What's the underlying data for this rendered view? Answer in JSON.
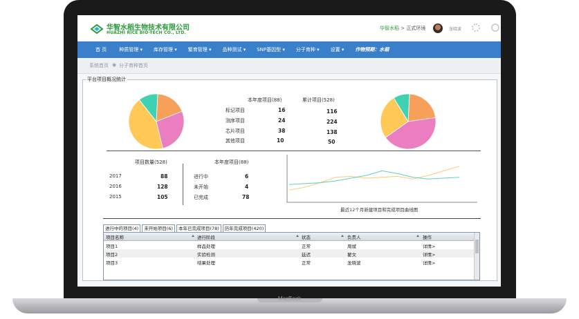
{
  "header": {
    "company_cn": "华智水稻生物技术有限公司",
    "company_en": "HUAZHI RICE BIO-TECH CO., LTD.",
    "crumb_link": "华智水稻",
    "crumb_sep": ">",
    "crumb_env": "正式环境",
    "user_name": "龙晓波"
  },
  "nav": {
    "items": [
      "首 页",
      "种质管理 ▾",
      "库存管理 ▾",
      "繁育管理 ▾",
      "品种测试 ▾",
      "SNP基因型 ▾",
      "分子育种 ▾",
      "设置 ▾"
    ],
    "crop": "作物预期：水稻"
  },
  "breadcrumb": {
    "first": "系统首页",
    "sep": "◉",
    "current": "分子育种首页"
  },
  "panel": {
    "legend": "平台项目概况统计"
  },
  "year_stats": {
    "header": "本年度项目(88)",
    "rows": [
      {
        "label": "标记项目",
        "value": "16"
      },
      {
        "label": "测序项目",
        "value": "24"
      },
      {
        "label": "芯片项目",
        "value": "38"
      },
      {
        "label": "其他项目",
        "value": "10"
      }
    ]
  },
  "total_stats": {
    "header": "累计项目(528)",
    "values": [
      "116",
      "224",
      "138",
      "50"
    ]
  },
  "project_count": {
    "header": "项目数量(528)",
    "rows": [
      {
        "label": "2017",
        "value": "88"
      },
      {
        "label": "2016",
        "value": "128"
      },
      {
        "label": "2015",
        "value": "105"
      }
    ]
  },
  "year_status": {
    "header": "本年度项目(88)",
    "rows": [
      {
        "label": "进行中",
        "value": "6"
      },
      {
        "label": "未开始",
        "value": "4"
      },
      {
        "label": "已完成",
        "value": "78"
      }
    ]
  },
  "chart_data": [
    {
      "type": "pie",
      "values": [
        16,
        24,
        38,
        10
      ],
      "colors": [
        "#f7a05a",
        "#ea7ec0",
        "#ffc857",
        "#3fd1b1"
      ]
    },
    {
      "type": "pie",
      "values": [
        116,
        224,
        138,
        50
      ],
      "colors": [
        "#f7a05a",
        "#ea7ec0",
        "#ffc857",
        "#3fd1b1"
      ]
    },
    {
      "type": "line",
      "title": "最近12个月新建项目和完成项目曲线图",
      "x": [
        1,
        2,
        3,
        4,
        5,
        6,
        7,
        8,
        9,
        10,
        11,
        12
      ],
      "series": [
        {
          "color": "#ffc879",
          "values": [
            12,
            15,
            20,
            26,
            27,
            25,
            26,
            27,
            24,
            28,
            33,
            38
          ]
        },
        {
          "color": "#5cd0c0",
          "values": [
            18,
            19,
            20,
            22,
            25,
            28,
            33,
            30,
            26,
            24,
            25,
            26
          ]
        }
      ],
      "ylim": [
        0,
        50
      ]
    }
  ],
  "tabs": [
    "进行中的项目(4)",
    "未开始项目(6)",
    "本年已完成项目(78)",
    "历年完成项目(420)"
  ],
  "table": {
    "columns": [
      "项目名称",
      "进行阶段",
      "状态",
      "负责人",
      "操作"
    ],
    "rows": [
      [
        "项目1",
        "样品处理",
        "正常",
        "周斌",
        "详情>"
      ],
      [
        "项目2",
        "实验检测",
        "延迟",
        "翟文",
        "详情>"
      ],
      [
        "项目3",
        "结果处理",
        "正常",
        "龙晓波",
        "详情>"
      ]
    ]
  },
  "device": {
    "brand": "MacBook"
  }
}
